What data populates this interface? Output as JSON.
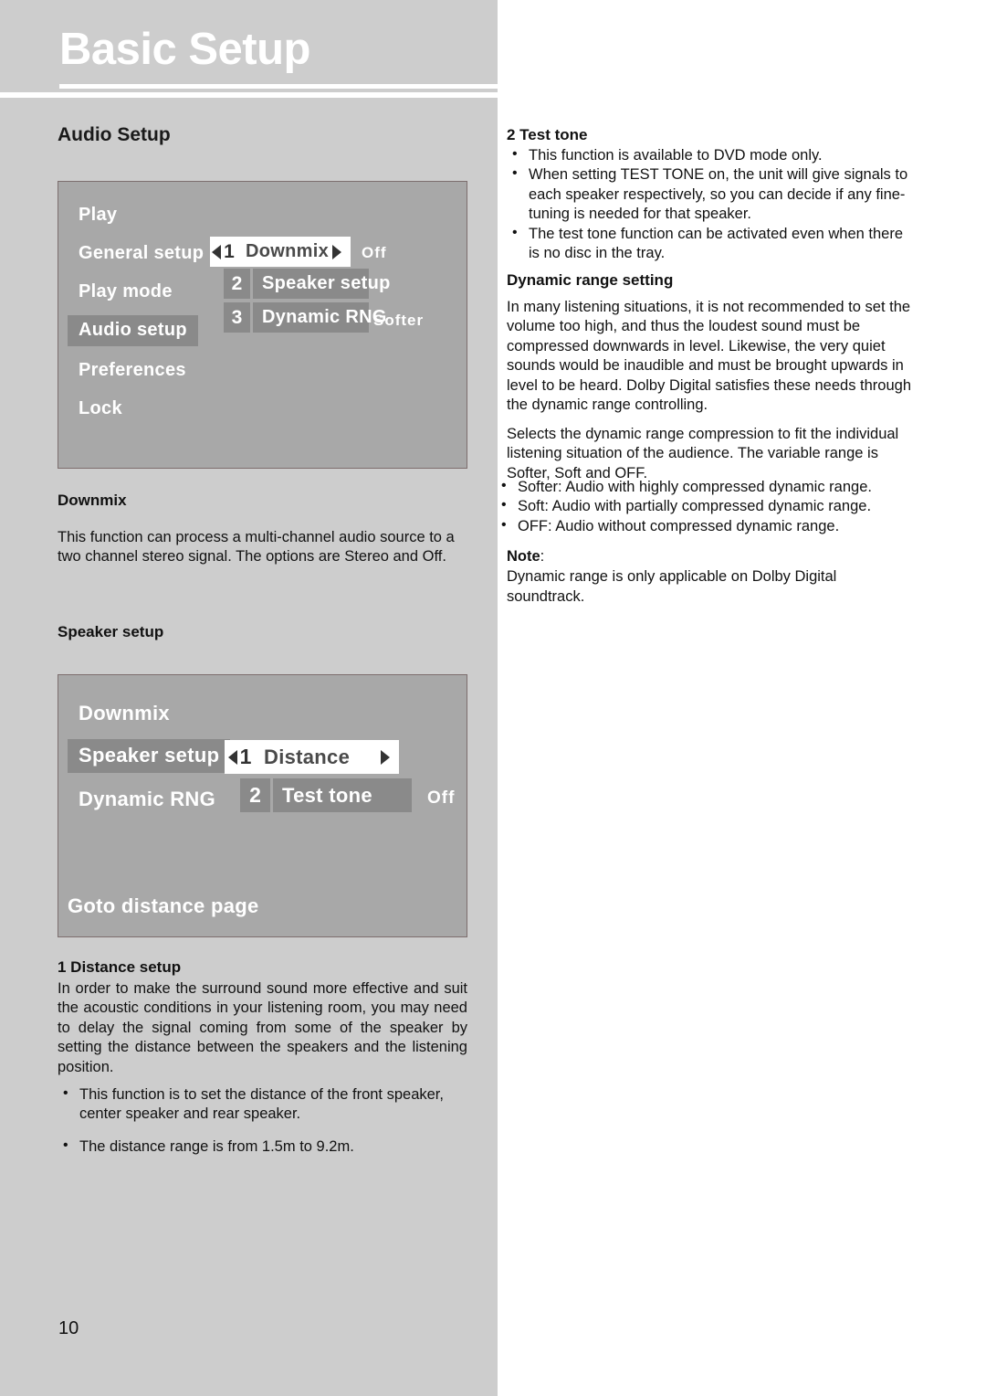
{
  "page": {
    "masthead_title": "Basic Setup",
    "page_number": "10"
  },
  "left_column": {
    "section_heading": "Audio Setup",
    "osd_audio_setup": {
      "menu": [
        {
          "label": "Play",
          "selected": false
        },
        {
          "label": "General setup",
          "selected": false
        },
        {
          "label": "Play mode",
          "selected": false
        },
        {
          "label": "Audio setup",
          "selected": true
        },
        {
          "label": "Preferences",
          "selected": false
        },
        {
          "label": "Lock",
          "selected": false
        }
      ],
      "rows": [
        {
          "number": "1",
          "label": "Downmix",
          "value": "Off",
          "active": true
        },
        {
          "number": "2",
          "label": "Speaker setup",
          "value": "",
          "active": false
        },
        {
          "number": "3",
          "label": "Dynamic RNG",
          "value": "Softer",
          "active": false
        }
      ]
    },
    "downmix": {
      "heading": "Downmix",
      "paragraph": "This function can process a multi-channel audio source to a two channel stereo signal. The options are Stereo and Off."
    },
    "speaker_setup": {
      "heading": "Speaker setup"
    },
    "osd_speaker_setup": {
      "menu": [
        {
          "label": "Downmix",
          "selected": false
        },
        {
          "label": "Speaker setup",
          "selected": true
        },
        {
          "label": "Dynamic RNG",
          "selected": false
        }
      ],
      "rows": [
        {
          "number": "1",
          "label": "Distance",
          "value": "",
          "active": true
        },
        {
          "number": "2",
          "label": "Test tone",
          "value": "Off",
          "active": false
        }
      ],
      "footer": "Goto distance page"
    },
    "distance_setup": {
      "heading": "1 Distance setup",
      "paragraph": "In order to make the surround sound more effective and suit the acoustic conditions in your listening room, you may need to delay the signal coming from some of the speaker by setting the distance between the speakers and the listening position.",
      "bullets": [
        "This function is to set the distance of the front speaker, center speaker and rear speaker.",
        "The distance range is from 1.5m to 9.2m."
      ]
    }
  },
  "right_column": {
    "test_tone": {
      "heading": "2 Test tone",
      "bullets": [
        "This function is available to DVD mode only.",
        "When setting TEST TONE on, the unit will give signals to each speaker respectively, so you can decide if any fine-tuning is needed for that speaker.",
        "The test tone function can be activated even when there is no disc in the tray."
      ]
    },
    "dynamic_range": {
      "heading": "Dynamic range setting",
      "paragraph_1": "In many listening situations, it is not recommended to set the volume too high, and thus the loudest sound must be compressed downwards in level. Likewise, the very quiet sounds would be inaudible and must be brought upwards in level to be heard. Dolby Digital satisfies these needs through the dynamic range controlling.",
      "paragraph_2": "Selects the dynamic range compression to fit the individual listening situation of the audience. The variable range is Softer, Soft and OFF.",
      "bullets": [
        "Softer: Audio with highly compressed dynamic range.",
        "Soft: Audio with partially compressed dynamic range.",
        "OFF: Audio without compressed dynamic range."
      ],
      "note_label": "Note",
      "note_text": "Dynamic range is only applicable on Dolby Digital soundtrack."
    }
  },
  "colors": {
    "band_gray": "#cdcdcd",
    "osd_bg": "#a8a8a8",
    "osd_selected": "#8a8a8a",
    "osd_active": "#ffffff"
  }
}
